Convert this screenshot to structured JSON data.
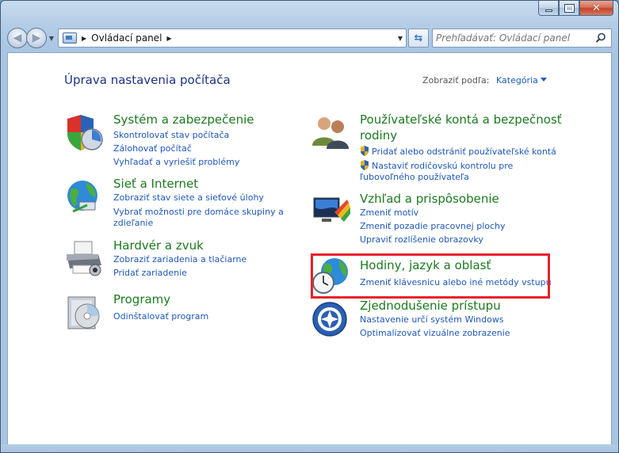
{
  "address": {
    "breadcrumb": "Ovládací panel"
  },
  "search": {
    "placeholder": "Prehľadávať: Ovládací panel"
  },
  "page": {
    "title": "Úprava nastavenia počítača"
  },
  "view_by": {
    "label": "Zobraziť podľa:",
    "value": "Kategória"
  },
  "categories": [
    {
      "title": "Systém a zabezpečenie",
      "icon": "security-shield-icon",
      "links": [
        "Skontrolovať stav počítača",
        "Zálohovať počítač",
        "Vyhľadať a vyriešiť problémy"
      ]
    },
    {
      "title": "Sieť a Internet",
      "icon": "network-globe-icon",
      "links": [
        "Zobraziť stav siete a sieťové úlohy",
        "Vybrať možnosti pre domáce skupiny a",
        "zdieľanie"
      ]
    },
    {
      "title": "Hardvér a zvuk",
      "icon": "printer-icon",
      "links": [
        "Zobraziť zariadenia a tlačiarne",
        "Pridať zariadenie"
      ]
    },
    {
      "title": "Programy",
      "icon": "programs-disc-icon",
      "links": [
        "Odinštalovať program"
      ]
    },
    {
      "title": "Používateľské kontá a bezpečnosť",
      "title2": "rodiny",
      "icon": "users-icon",
      "links": [
        "Pridať alebo odstrániť používateľské kontá",
        "Nastaviť rodičovskú kontrolu pre",
        "ľubovoľného používateľa"
      ]
    },
    {
      "title": "Vzhľad a prispôsobenie",
      "icon": "appearance-monitor-icon",
      "links": [
        "Zmeniť motív",
        "Zmeniť pozadie pracovnej plochy",
        "Upraviť rozlíšenie obrazovky"
      ]
    },
    {
      "title": "Hodiny, jazyk a oblasť",
      "icon": "clock-globe-icon",
      "links": [
        "Zmeniť klávesnicu alebo iné metódy vstupu"
      ]
    },
    {
      "title": "Zjednodušenie prístupu",
      "icon": "accessibility-icon",
      "links": [
        "Nastavenie určí systém Windows",
        "Optimalizovať vizuálne zobrazenie"
      ]
    }
  ],
  "colors": {
    "highlight": "#e8202a",
    "link": "#1f58b8",
    "category_title": "#1b7a1f",
    "page_title": "#1e3287"
  }
}
